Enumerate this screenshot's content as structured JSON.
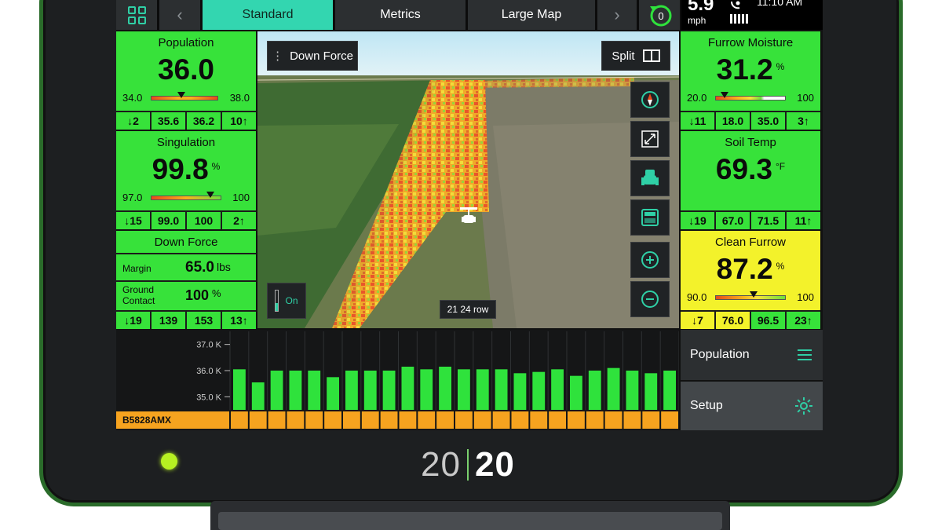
{
  "topbar": {
    "tabs": [
      "Standard",
      "Metrics",
      "Large Map"
    ],
    "active_tab": "Standard",
    "alert_count": "0",
    "speed_value": "5.9",
    "speed_unit": "mph",
    "clock": "11:10 AM"
  },
  "left_panels": {
    "population": {
      "title": "Population",
      "value": "36.0",
      "range_lo": "34.0",
      "range_hi": "38.0",
      "level": 0.45,
      "foot": [
        "2",
        "35.6",
        "36.2",
        "10"
      ]
    },
    "singulation": {
      "title": "Singulation",
      "value": "99.8",
      "unit": "%",
      "range_lo": "97.0",
      "range_hi": "100",
      "level": 0.85,
      "foot": [
        "15",
        "99.0",
        "100",
        "2"
      ]
    },
    "down_force": {
      "title": "Down Force",
      "margin_label": "Margin",
      "margin_value": "65.0",
      "margin_unit": "lbs",
      "ground_label_1": "Ground",
      "ground_label_2": "Contact",
      "ground_value": "100",
      "ground_unit": "%",
      "foot": [
        "19",
        "139",
        "153",
        "13"
      ]
    }
  },
  "right_panels": {
    "furrow_moisture": {
      "title": "Furrow Moisture",
      "value": "31.2",
      "unit": "%",
      "range_lo": "20.0",
      "range_hi": "100",
      "level": 0.12,
      "foot": [
        "11",
        "18.0",
        "35.0",
        "3"
      ]
    },
    "soil_temp": {
      "title": "Soil Temp",
      "value": "69.3",
      "unit": "°F",
      "foot": [
        "19",
        "67.0",
        "71.5",
        "11"
      ]
    },
    "clean_furrow": {
      "title": "Clean Furrow",
      "value": "87.2",
      "unit": "%",
      "range_lo": "90.0",
      "range_hi": "100",
      "level": 0.55,
      "foot": [
        "7",
        "76.0",
        "96.5",
        "23"
      ]
    }
  },
  "map": {
    "layer_button": "Down Force",
    "split_button": "Split",
    "on_toggle": "On",
    "row_label": "21 24 row"
  },
  "chart_data": {
    "type": "bar",
    "series_label": "B5828AMX",
    "ylim": [
      34.5,
      37.5
    ],
    "yticks": [
      "37.0 K",
      "36.0 K",
      "35.0 K"
    ],
    "ytick_values": [
      37.0,
      36.0,
      35.0
    ],
    "values": [
      36.05,
      35.55,
      36.0,
      36.0,
      36.0,
      35.75,
      36.0,
      36.0,
      36.0,
      36.15,
      36.05,
      36.15,
      36.05,
      36.05,
      36.05,
      35.9,
      35.95,
      36.05,
      35.8,
      36.0,
      36.1,
      36.0,
      35.9,
      36.0
    ]
  },
  "right_menu": {
    "population_label": "Population",
    "setup_label": "Setup"
  },
  "device": {
    "brand_a": "20",
    "brand_b": "20"
  },
  "colors": {
    "panel_green": "#37e23a",
    "panel_yellow": "#f3f22b",
    "accent_teal": "#33d6b0",
    "chart_bar": "#2fe23c",
    "chart_base": "#f6a31f"
  }
}
